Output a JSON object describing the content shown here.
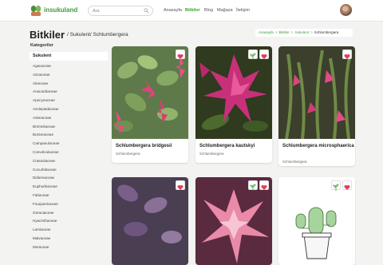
{
  "header": {
    "brand": "insukuland",
    "search": {
      "placeholder": "Ara"
    },
    "nav": [
      "Anasayfa",
      "Bitkiler",
      "Blog",
      "Mağaza",
      "İletişim"
    ],
    "active_nav": "Bitkiler"
  },
  "page": {
    "title": "Bitkiler",
    "subtitle": "/ Sukulent/ Schlumbergera",
    "breadcrumb": [
      "Anasayfa",
      "Bitkiler",
      "Sukulent",
      "Schlumbergera"
    ]
  },
  "sidebar": {
    "heading": "Kategoriler",
    "active": "Sukulent",
    "items": [
      "Agavaceae",
      "Aizoaceae",
      "Aloeceae",
      "Anacardiaceae",
      "Apocynaceae",
      "Asclepiadaceae",
      "Asteraceae",
      "Bromeliaceae",
      "Burseraceae",
      "Campanulaceae",
      "Convolvulaceae",
      "Crassulaceae",
      "Cucurbitaceae",
      "Didiereaceae",
      "Euphorbiaceae",
      "Fabaceae",
      "Fouquieriaceae",
      "Geraniaceae",
      "Hyacinthaceae",
      "Lamiaceae",
      "Malvaceae",
      "Moraceae"
    ]
  },
  "plants": [
    {
      "name": "Schlumbergera bridgesii",
      "genus": "Schlumbergera"
    },
    {
      "name": "Schlumbergera kautskyi",
      "genus": "Schlumbergera"
    },
    {
      "name": "Schlumbergera microsphaerica",
      "genus": "Schlumbergera"
    },
    {
      "name": "",
      "genus": ""
    },
    {
      "name": "",
      "genus": ""
    },
    {
      "name": "",
      "genus": ""
    }
  ],
  "colors": {
    "brand": "#3f9b36",
    "heart": "#e0405a",
    "background": "#f3f4f2"
  },
  "icons": [
    "search-icon",
    "plant-icon",
    "heart-icon"
  ]
}
